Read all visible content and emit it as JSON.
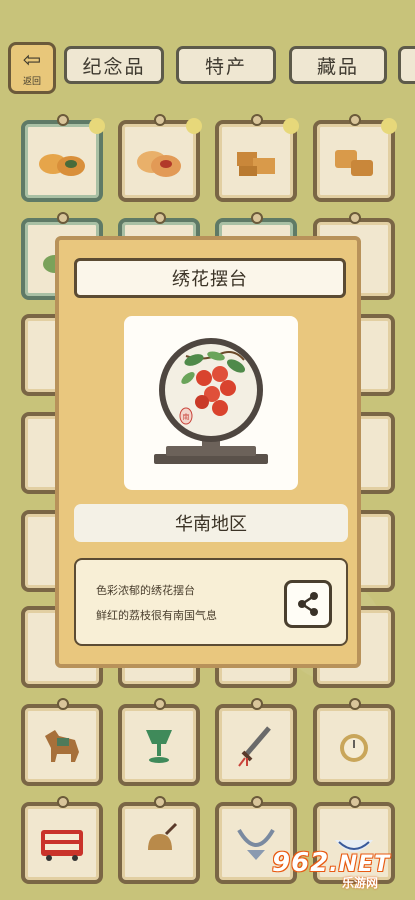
{
  "topbar": {
    "back_label": "返回",
    "tabs": [
      "纪念品",
      "特产",
      "藏品"
    ]
  },
  "popup": {
    "title": "绣花摆台",
    "region": "华南地区",
    "desc_line1": "色彩浓郁的绣花摆台",
    "desc_line2": "鲜红的荔枝很有南国气息",
    "seal_text": "南"
  },
  "watermark": {
    "main": "962",
    "net": ".NET",
    "sub": "乐游网"
  },
  "colors": {
    "background": "#c8c37a",
    "popup_bg": "#e9c77e",
    "frame_brown": "#7a6645",
    "frame_green": "#5f7a66",
    "accent_red": "#d9432e"
  },
  "icons": {
    "back": "back-arrow-icon",
    "share": "share-icon"
  }
}
